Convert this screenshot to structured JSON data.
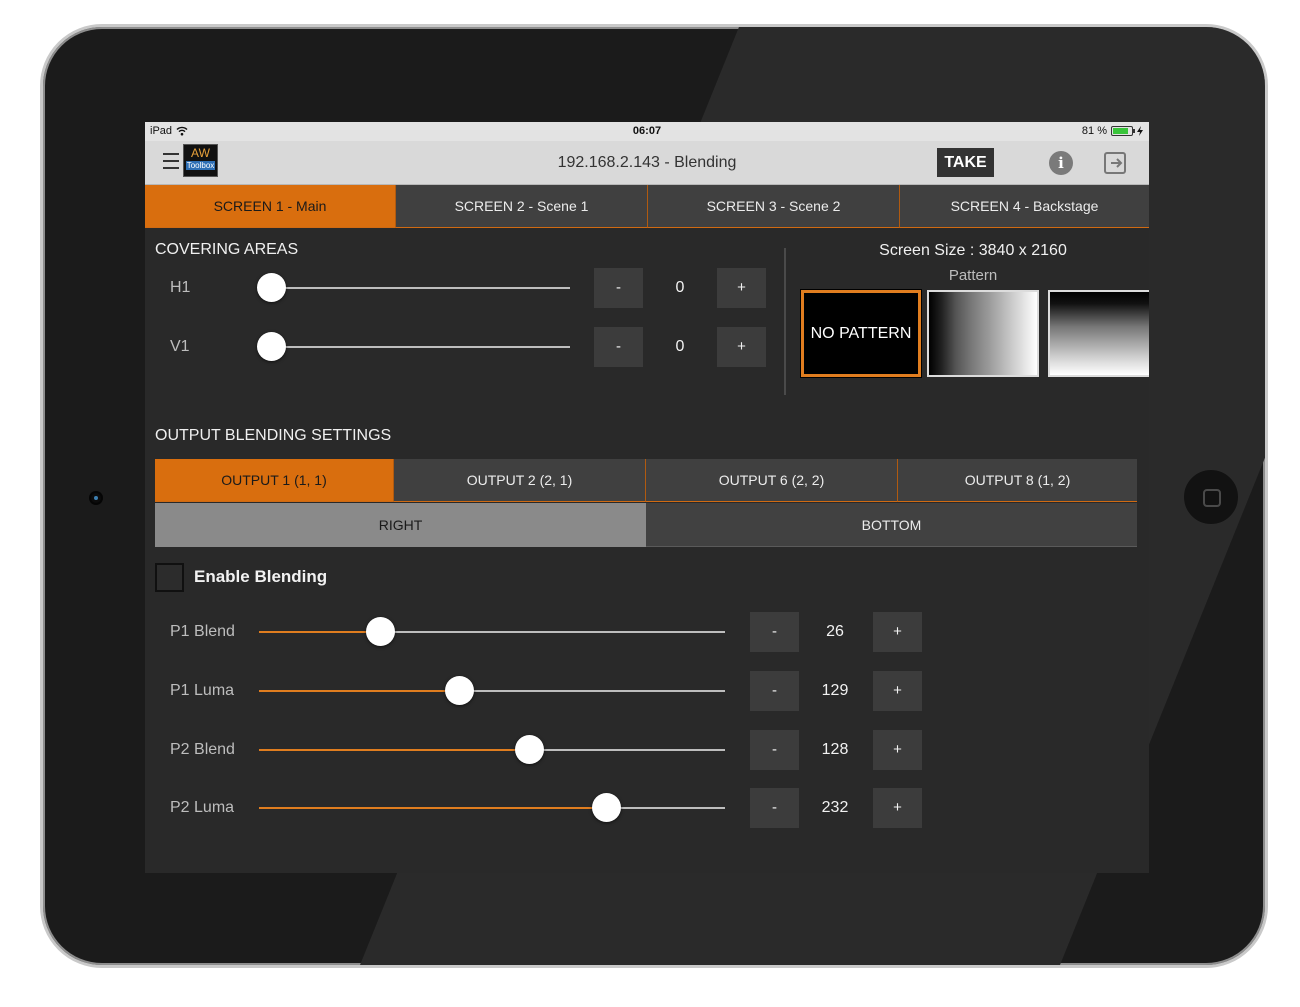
{
  "status_bar": {
    "device": "iPad",
    "time": "06:07",
    "battery_text": "81 %",
    "battery_level": 0.81
  },
  "nav": {
    "logo_top": "AW",
    "logo_bottom": "Toolbox",
    "title": "192.168.2.143 - Blending",
    "take_label": "TAKE",
    "info_symbol": "i",
    "icons": [
      "menu-icon",
      "info-icon",
      "logout-icon"
    ]
  },
  "screen_tabs": [
    {
      "label": "SCREEN 1 - Main",
      "active": true
    },
    {
      "label": "SCREEN 2 - Scene 1",
      "active": false
    },
    {
      "label": "SCREEN 3 - Scene 2",
      "active": false
    },
    {
      "label": "SCREEN 4 - Backstage",
      "active": false
    }
  ],
  "covering": {
    "title": "COVERING AREAS",
    "rows": [
      {
        "label": "H1",
        "value": "0",
        "minus": "-",
        "plus": "+",
        "fraction": 0.0
      },
      {
        "label": "V1",
        "value": "0",
        "minus": "-",
        "plus": "+",
        "fraction": 0.0
      }
    ]
  },
  "pattern": {
    "screen_size": "Screen Size : 3840 x 2160",
    "label": "Pattern",
    "options": [
      {
        "label": "NO PATTERN",
        "selected": true
      },
      {
        "label": "",
        "selected": false
      },
      {
        "label": "",
        "selected": false
      }
    ]
  },
  "output_blending": {
    "title": "OUTPUT BLENDING SETTINGS",
    "outputs": [
      {
        "label": "OUTPUT 1 (1, 1)",
        "active": true
      },
      {
        "label": "OUTPUT 2 (2, 1)",
        "active": false
      },
      {
        "label": "OUTPUT 6 (2, 2)",
        "active": false
      },
      {
        "label": "OUTPUT 8 (1, 2)",
        "active": false
      }
    ],
    "edges": [
      {
        "label": "RIGHT",
        "active": true
      },
      {
        "label": "BOTTOM",
        "active": false
      }
    ],
    "enable_label": "Enable Blending",
    "enabled": false,
    "sliders": [
      {
        "label": "P1 Blend",
        "value": "26",
        "minus": "-",
        "plus": "+",
        "fraction": 0.26
      },
      {
        "label": "P1 Luma",
        "value": "129",
        "minus": "-",
        "plus": "+",
        "fraction": 0.43
      },
      {
        "label": "P2 Blend",
        "value": "128",
        "minus": "-",
        "plus": "+",
        "fraction": 0.58
      },
      {
        "label": "P2 Luma",
        "value": "232",
        "minus": "-",
        "plus": "+",
        "fraction": 0.745
      }
    ]
  },
  "colors": {
    "accent": "#d96e0e",
    "panel": "#292929",
    "button": "#3c3c3c"
  }
}
